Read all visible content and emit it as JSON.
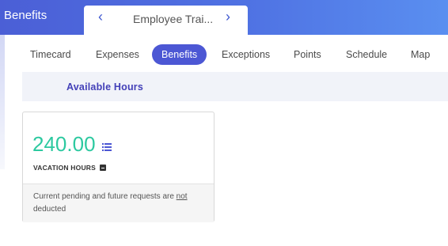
{
  "header": {
    "app_title": "Benefits",
    "employee_name": "Employee Trai...",
    "prev_label": "‹",
    "next_label": "›"
  },
  "tabs": [
    {
      "label": "Timecard",
      "active": false
    },
    {
      "label": "Expenses",
      "active": false
    },
    {
      "label": "Benefits",
      "active": true
    },
    {
      "label": "Exceptions",
      "active": false
    },
    {
      "label": "Points",
      "active": false
    },
    {
      "label": "Schedule",
      "active": false
    },
    {
      "label": "Map",
      "active": false
    }
  ],
  "section": {
    "title": "Available Hours"
  },
  "card": {
    "value": "240.00",
    "label": "VACATION HOURS",
    "note_before": "Current pending and future requests are ",
    "note_emphasis": "not",
    "note_after": "deducted"
  },
  "colors": {
    "accent": "#4c57d4",
    "value": "#2dc9a0",
    "section_title": "#4340b8"
  }
}
